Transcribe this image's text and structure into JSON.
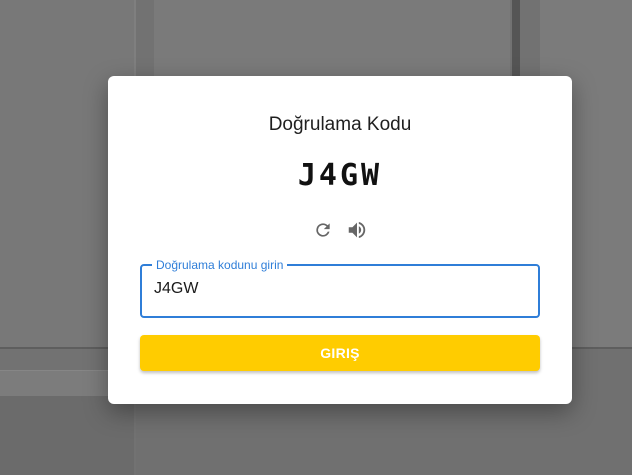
{
  "modal": {
    "title": "Doğrulama Kodu",
    "captcha_code": "J4GW",
    "icons": {
      "refresh": "refresh-icon",
      "audio": "speaker-icon"
    },
    "input": {
      "label": "Doğrulama kodunu girin",
      "value": "J4GW"
    },
    "submit_label": "GIRIŞ"
  },
  "colors": {
    "accent": "#2f7ed8",
    "button": "#ffcc00",
    "overlay": "#727272"
  }
}
